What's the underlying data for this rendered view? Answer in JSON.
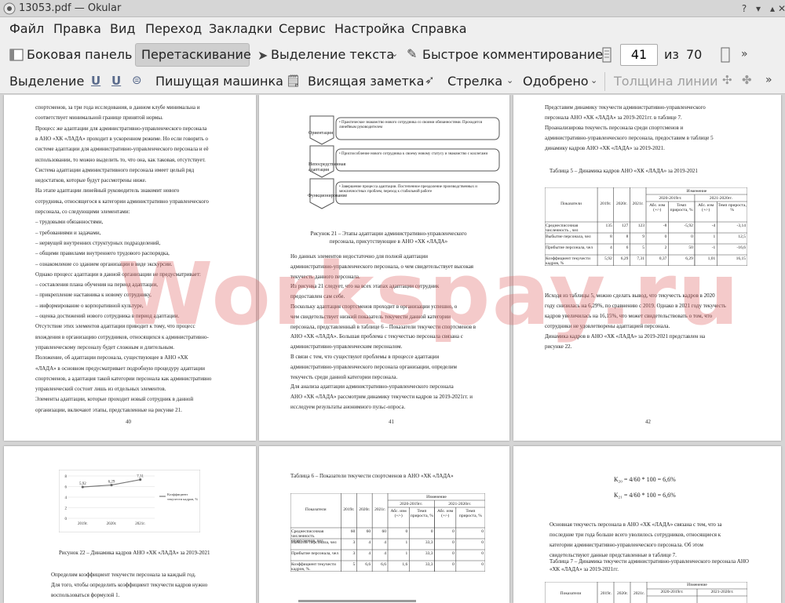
{
  "window": {
    "title": "13053.pdf — Okular"
  },
  "menu": [
    "Файл",
    "Правка",
    "Вид",
    "Переход",
    "Закладки",
    "Сервис",
    "Настройка",
    "Справка"
  ],
  "toolbar1": {
    "sidebar": "Боковая панель",
    "drag": "Перетаскивание",
    "select_text": "Выделение текста",
    "quick_comment": "Быстрое комментирование",
    "current_page": "41",
    "of_label": "из",
    "total_pages": "70"
  },
  "toolbar2": {
    "selection": "Выделение",
    "typewriter": "Пишущая машинка",
    "sticky_note": "Висящая заметка",
    "arrow": "Стрелка",
    "approved": "Одобрено",
    "line_width": "Толщина линии"
  },
  "pages": {
    "p40": {
      "lines": [
        "спортсменов, за три года исследования, в данном клубе минимальна и",
        "соответствует минимальной границе принятой нормы.",
        "Процесс же адаптации для административно-управленческого персонала",
        "в АНО «ХК «ЛАДА» проходит в ускоренном режиме. Но если говорить о",
        "системе адаптации для административно-управленческого персонала и её",
        "использовании, то можно выделить то, что она, как таковая, отсутствует.",
        "Система адаптации административного персонала имеет целый ряд",
        "недостатков, которые будут рассмотрены ниже.",
        "На этапе адаптации линейный руководитель знакомит нового",
        "сотрудника, относящегося к категории административно управленческого",
        "персонала, со следующими элементами:",
        "–   трудовыми обязанностями,",
        "–   требованиями и задачами,",
        "–   нервущей внутренних структурных подразделений,",
        "–   общими правилами внутреннего трудового распорядка,",
        "–   ознакомление со зданием организации в виде экскурсии.",
        "Однако процесс адаптации в данной организации не предусматривает:",
        "–   составления плана обучения на период адаптации,",
        "–   прикрепление наставника к новому сотруднику,",
        "–   информирование о корпоративной культуре,",
        "–   оценка достижений нового сотрудника в период адаптации.",
        "Отсутствие этих элементов адаптации приводит к тому, что процесс",
        "вхождения в организацию сотрудников, относящихся к административно-",
        "управленческому персоналу будет сложным и длительным.",
        "Положение, об адаптации персонала, существующее в АНО «ХК",
        "«ЛАДА» в основном предусматривает подробную процедуру адаптации",
        "спортсменов, а адаптация такой категории персонала как административно",
        "управленческий состоит лишь из отдельных элементов.",
        "Элементы адаптации, которые проходит новый сотрудник в данной",
        "организации, включают этапы, представленные на рисунке 21."
      ],
      "number": "40"
    },
    "p41": {
      "diagram": {
        "stages": [
          "Ориентация",
          "Непосредственная адаптация",
          "Функционирование"
        ],
        "items": [
          "• Практическое знакомство нового сотрудника со своими обязанностями. Проходится линейным руководителем",
          "• Приспособление нового сотрудника к своему новому статусу и знакомство с коллегами",
          "• Завершение процесса адаптации. Постепенное преодоление производственных и межличностных проблем, переход к стабильной работе"
        ]
      },
      "caption": "Рисунок 21 – Этапы адаптации административно-управленческого персонала, присутствующие в АНО «ХК «ЛАДА»",
      "lines": [
        "Но данных элементов недостаточно для полной адаптации",
        "административно-управленческого персонала, о чем свидетельствует высокая",
        "текучесть данного персонала.",
        "Из рисунка 21 следует, что на всех этапах адаптации сотрудник",
        "предоставлен сам себе.",
        "Поскольку адаптация спортсменов проходит в организации успешно, о",
        "чем свидетельствует низкий показатель текучести данной категории",
        "персонала, представленный в таблице 6 – Показатели текучести спортсменов в",
        "АНО «ХК «ЛАДА». Большая проблема с текучестью персонала связана с",
        "административно-управленческим персоналом.",
        "В связи с тем, что существуют проблемы в процессе адаптации",
        "административно-управленческого персонала организации, определим",
        "текучесть среди данной категории персонала.",
        "Для анализа адаптации административно-управленческого персонала",
        "АНО «ХК «ЛАДА» рассмотрим динамику текучести кадров за 2019-2021гг. и",
        "исследуем результаты анонимного пульс-опроса."
      ],
      "number": "41"
    },
    "p42": {
      "lines_top": [
        "Представим динамику текучести административно-управленческого",
        "персонала АНО «ХК «ЛАДА» за 2019-2021гг. в таблице 7.",
        "Проанализирова текучесть персонала среди спортсменов и",
        "административно-управленческого персонала, предоставим в таблице 5",
        "динамику кадров АНО «ХК «ЛАДА» за 2019-2021."
      ],
      "table_title": "Таблица 5 – Динамика кадров АНО «ХК «ЛАДА» за 2019-2021",
      "table": {
        "headers": [
          "Показатели",
          "2019г.",
          "2020г.",
          "2021г.",
          "Изменение"
        ],
        "subheaders": [
          "2020-2019гг.",
          "2021-2020гг."
        ],
        "subsub": [
          "Абс. изм (+/-)",
          "Темп прироста, %",
          "Абс. изм (+/-)",
          "Темп прироста, %"
        ],
        "rows": [
          [
            "Среднесписочная численность , чел",
            "135",
            "127",
            "123",
            "-8",
            "-5,92",
            "-4",
            "-3,14"
          ],
          [
            "Выбытие персонала, чел",
            "8",
            "8",
            "9",
            "0",
            "0",
            "1",
            "12,5"
          ],
          [
            "Прибытие персонала, чел",
            "4",
            "6",
            "5",
            "2",
            "50",
            "-1",
            "-16,6"
          ],
          [
            "Коэффициент текучести кадров, %",
            "5,92",
            "6,29",
            "7,31",
            "0,37",
            "6,29",
            "1,01",
            "16,15"
          ]
        ]
      },
      "lines_bottom": [
        "Исходя из таблицы 5, можно сделать вывод, что текучесть кадров в 2020",
        "году снизилась на 6,29%, по сравнению с 2019. Однако в 2021 году текучесть",
        "кадров увеличилась на 16,15%, что может свидетельствовать о том, что",
        "сотрудники не удовлетворены адаптацией персонала.",
        "Динамика кадров в АНО «ХК «ЛАДА» за 2019-2021 представлен на",
        "рисунке 22."
      ],
      "number": "42"
    },
    "p43": {
      "chart_data": {
        "type": "line",
        "categories": [
          "2019г.",
          "2020г.",
          "2021г."
        ],
        "series": [
          {
            "name": "Коэффициент текучести кадров, %",
            "values": [
              5.92,
              6.29,
              7.31
            ]
          }
        ],
        "point_labels": [
          "5,92",
          "6,29",
          "7,31"
        ],
        "yticks": [
          "0",
          "2",
          "4",
          "6",
          "8"
        ],
        "ylim": [
          0,
          8
        ],
        "legend": "right"
      },
      "caption": "Рисунок 22 – Динамика кадров АНО «ХК «ЛАДА» за 2019-2021",
      "lines": [
        "Определим коэффициент текучести персонала за каждый год.",
        "Для того, чтобы определить коэффициент текучести кадров нужно",
        "воспользоваться формулой 1."
      ]
    },
    "p44": {
      "table_title": "Таблица 6 – Показатели текучести спортсменов в АНО «ХК «ЛАДА»",
      "table": {
        "headers": [
          "Показатели",
          "2019г.",
          "2020г.",
          "2021г.",
          "Изменение"
        ],
        "subheaders": [
          "2020-2019гг.",
          "2021-2020гг."
        ],
        "subsub": [
          "Абс. изм (+/-)",
          "Темп прироста, %",
          "Абс. изм (+/-)",
          "Темп прироста, %"
        ],
        "rows": [
          [
            "Среднесписочная численность спортсменов, чел.",
            "60",
            "60",
            "60",
            "0",
            "0",
            "0",
            "0"
          ],
          [
            "Выбытие персонала, чел",
            "3",
            "4",
            "4",
            "1",
            "33,3",
            "0",
            "0"
          ],
          [
            "Прибытие персонала, чел",
            "3",
            "4",
            "4",
            "1",
            "33,3",
            "0",
            "0"
          ],
          [
            "Коэффициент текучести кадров, %.",
            "5",
            "6,6",
            "6,6",
            "1,6",
            "33,3",
            "0",
            "0"
          ]
        ]
      }
    },
    "p45": {
      "formulas": [
        "К₂₀ = 4/60 * 100 = 6,6%",
        "К₂₁ = 4/60 * 100 = 6,6%"
      ],
      "lines": [
        "Основная текучесть персонала в АНО «ХК «ЛАДА» связана с тем, что за",
        "последние три года больше всего уволилось сотрудников, относящиеся к",
        "категории административно-управленческого персонала. Об этом",
        "свидетельствуют данные представленные в таблице 7."
      ],
      "table_title": "Таблица 7 – Динамика текучести административно-управленческого персонала АНО «ХК «ЛАДА» за 2019-2021гг.",
      "table_headers": [
        "Показатели",
        "2019г.",
        "2020г.",
        "2021г.",
        "Изменение",
        "2020-2019гг.",
        "2021-2020гг."
      ]
    }
  },
  "watermark": "Workspay.ru"
}
